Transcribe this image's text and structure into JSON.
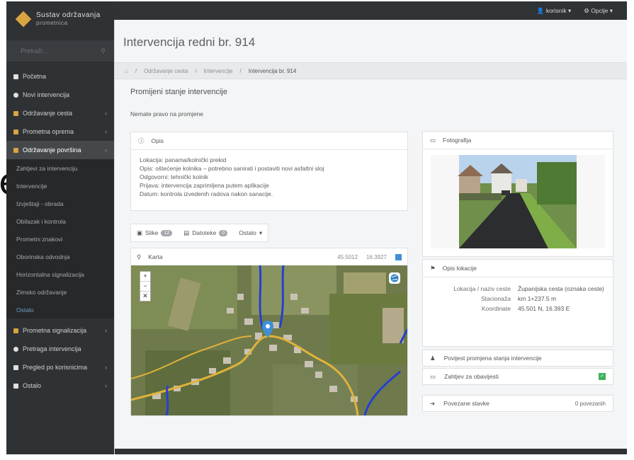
{
  "edge_glyph": "e",
  "app": {
    "logo_title": "Sustav održavanja",
    "logo_subtitle": "prometnica"
  },
  "topbar": {
    "user_label": "korisnik",
    "settings_label": "Opcije"
  },
  "sidebar": {
    "search_placeholder": "Pretraži...",
    "items": [
      {
        "label": "Početna",
        "color": "#e0e0e0"
      },
      {
        "label": "Novi intervencija",
        "color": "#e0e0e0"
      },
      {
        "label": "Održavanje cesta",
        "color": "#d9a441"
      },
      {
        "label": "Prometna oprema",
        "color": "#d9a441"
      },
      {
        "label": "Održavanje površina",
        "color": "#d9a441"
      }
    ],
    "submenu": [
      "Zahtjevi za intervenciju",
      "Intervencije",
      "Izvještaji - obrada",
      "Obilazak i kontrola",
      "Prometni znakovi",
      "Oborinska odvodnja",
      "Horizontalna signalizacija",
      "Zimsko održavanje",
      "Ostalo"
    ],
    "items_after": [
      {
        "label": "Prometna signalizacija",
        "color": "#d9a441"
      },
      {
        "label": "Pretraga intervencija",
        "color": "#e0e0e0"
      },
      {
        "label": "Pregled po korisnicima",
        "color": "#e0e0e0"
      },
      {
        "label": "Ostalo",
        "color": "#e0e0e0"
      }
    ]
  },
  "page": {
    "title": "Intervencija redni br. 914",
    "breadcrumb": [
      "Održavanje cesta",
      "Intervencije",
      "Intervencija br. 914"
    ],
    "section_title": "Promijeni stanje intervencije",
    "no_rights": "Nemate pravo na promjene"
  },
  "opis_card": {
    "title": "Opis",
    "lines": [
      "Lokacija: panama/kolnički prekid",
      "Opis: oštećenje kolnika – potrebno sanirati i postaviti novi asfaltni sloj",
      "Odgovorni: tehnički kolnik",
      "Prijava: intervencija zaprimljena putem aplikacije",
      "Datum: kontrola izvedenih radova nakon sanacije."
    ]
  },
  "tabs": {
    "photos_label": "Slike",
    "photos_count": "12",
    "docs_label": "Datoteke",
    "docs_count": "0",
    "more_label": "Ostalo"
  },
  "map_card": {
    "title": "Karta",
    "coord_a": "45.5012",
    "coord_b": "16.3927"
  },
  "photo_card": {
    "title": "Fotografija"
  },
  "info_card": {
    "title": "Opis lokacije",
    "rows": [
      {
        "label": "Lokacija / naziv ceste",
        "value": "Županijska cesta (oznaka ceste)"
      },
      {
        "label": "Stacionaža",
        "value": "km 1+237.5 m"
      },
      {
        "label": "Koordinate",
        "value": "45.501 N, 16.393 E"
      }
    ]
  },
  "actions": {
    "row1": "Povijest promjena stanja intervencije",
    "row2": "Zahtjev za obavijesti",
    "row3_left": "Povezane stavke",
    "row3_right": "0 povezanih"
  },
  "colors": {
    "accent": "#3f8fd6",
    "sidebar_bg": "#2f3234",
    "ok": "#3cb35c"
  }
}
